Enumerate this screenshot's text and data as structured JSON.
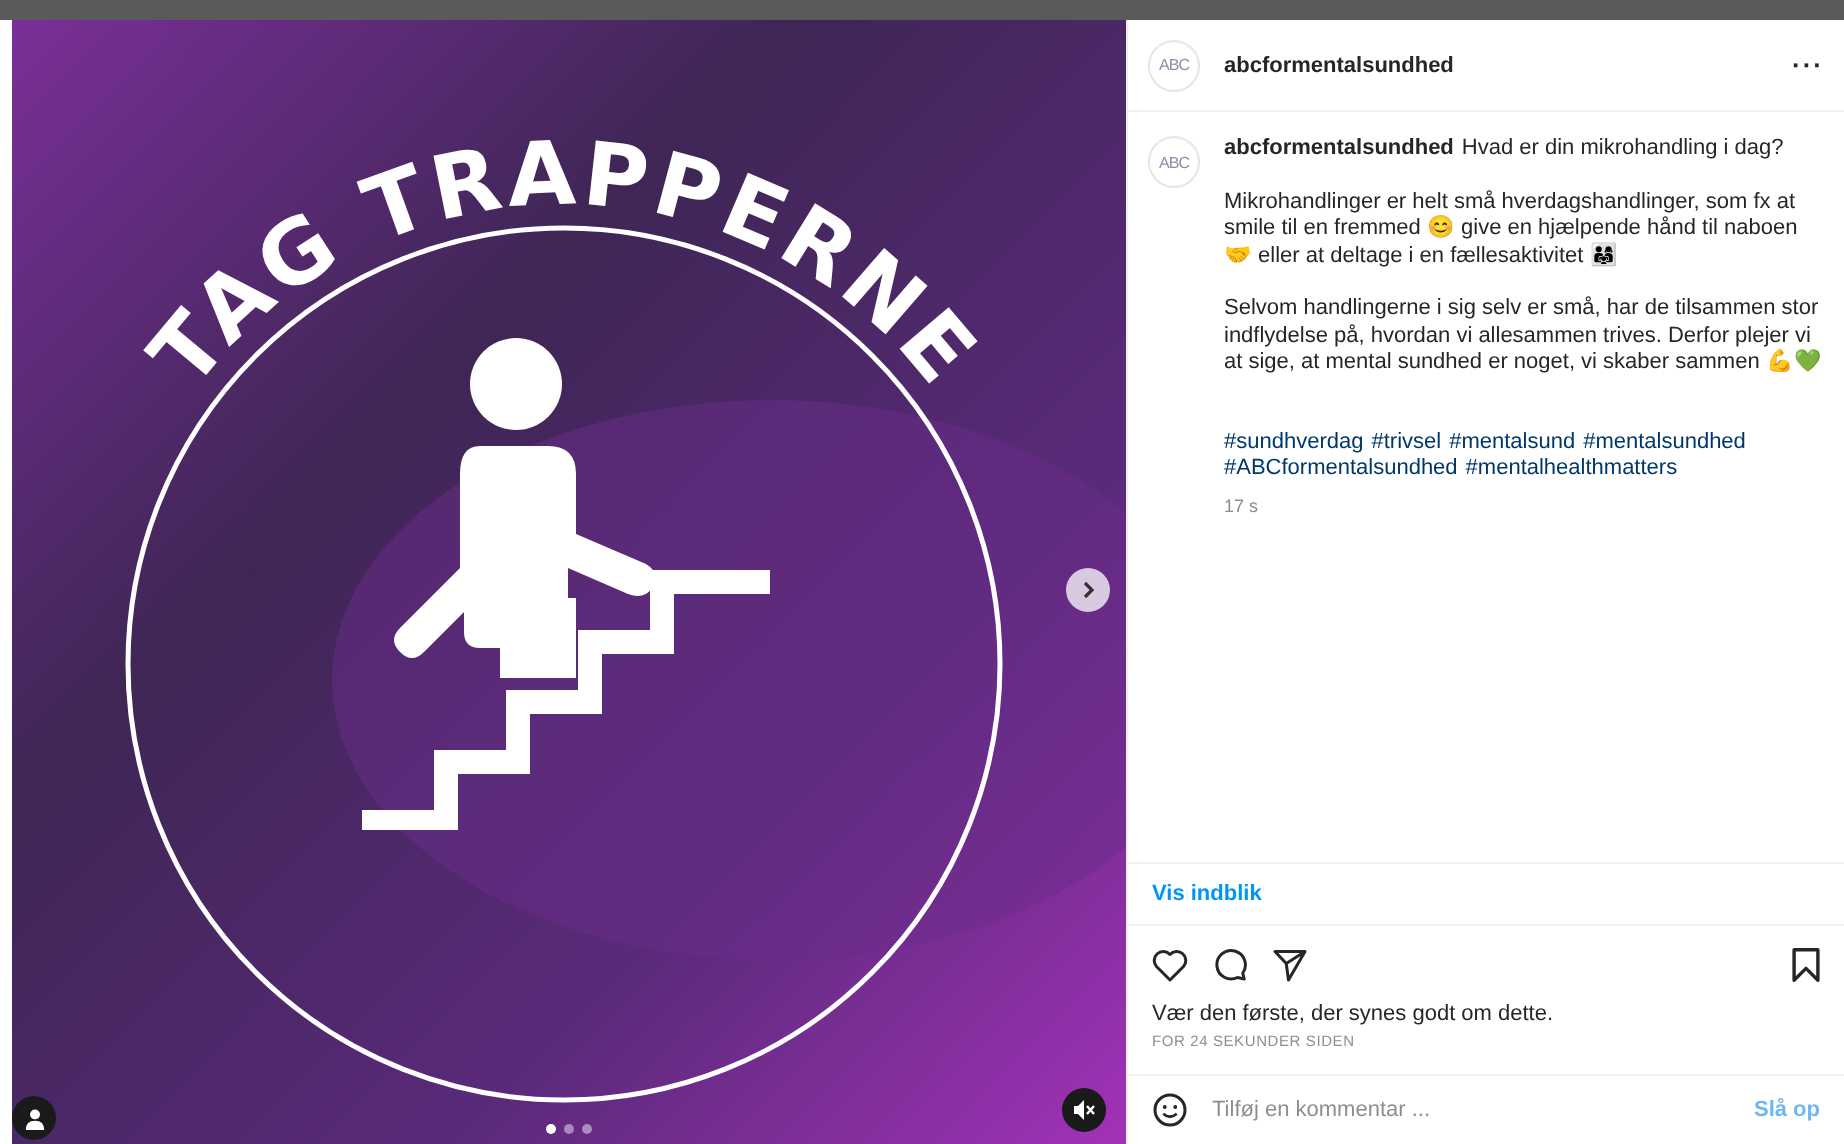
{
  "post_image": {
    "title": "TAG TRAPPERNE",
    "slides": [
      {
        "selected": true
      },
      {
        "selected": false
      },
      {
        "selected": false
      }
    ]
  },
  "header": {
    "username": "abcformentalsundhed",
    "avatar_text": "ABC",
    "more": "···"
  },
  "caption": {
    "avatar_text": "ABC",
    "username": "abcformentalsundhed",
    "first_line": "Hvad er din mikrohandling i dag?",
    "paragraphs": [
      "Mikrohandlinger er helt små hverdagshandlinger, som fx at smile til en fremmed 😊 give en hjælpende hånd til naboen 🤝 eller at deltage i en fællesaktivitet 👨‍👩‍👧",
      "Selvom handlingerne i sig selv er små, har de tilsammen stor indflydelse på, hvordan vi allesammen trives. Derfor plejer vi at sige, at mental sundhed er noget, vi skaber sammen 💪💚"
    ],
    "hashtags": [
      "#sundhverdag",
      "#trivsel",
      "#mentalsund",
      "#mentalsundhed",
      "#ABCformentalsundhed",
      "#mentalhealthmatters"
    ],
    "time": "17 s"
  },
  "insights_link": "Vis indblik",
  "likes_text": "Vær den første, der synes godt om dette.",
  "timestamp": "FOR 24 SEKUNDER SIDEN",
  "comment": {
    "placeholder": "Tilføj en kommentar ...",
    "post_button": "Slå op",
    "post_disabled": true
  }
}
